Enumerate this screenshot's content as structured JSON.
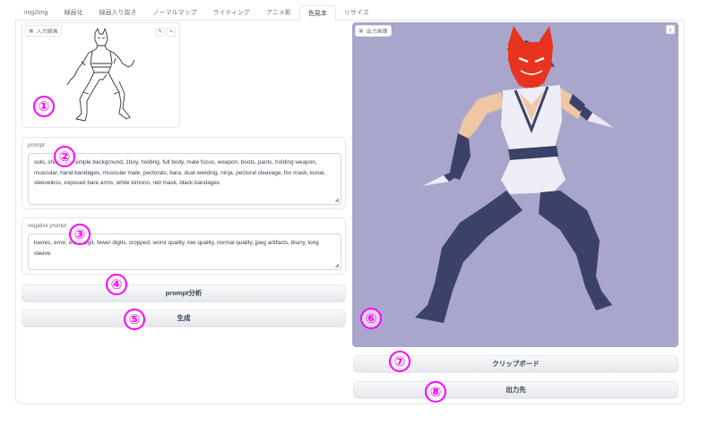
{
  "tabs": [
    "img2img",
    "線画化",
    "線画入り抜き",
    "ノーマルマップ",
    "ライティング",
    "アニメ影",
    "色見本",
    "リサイズ"
  ],
  "input_image": {
    "label": "入力線画",
    "edit_icon": "✎",
    "close_icon": "×"
  },
  "prompt": {
    "label": "prompt",
    "value": "solo, short hair, simple background, 1boy, holding, full body, male focus, weapon, boots, pants, holding weapon, muscular, hand bandages, muscular male, pectorals, bara, dual wielding, ninja, pectoral cleavage, fox mask, kunai, sleeveless, exposed bare arms,  white kimono, red mask, black bandages"
  },
  "negative_prompt": {
    "label": "negative prompt",
    "value": "lowres, error, extra digit, fewer digits, cropped, worst quality, low quality, normal quality, jpeg artifacts, blurry, long sleeve"
  },
  "buttons": {
    "analyze": "prompt分析",
    "generate": "生成",
    "clipboard": "クリップボード",
    "output_dest": "出力先"
  },
  "output_image": {
    "label": "出力画像",
    "download_icon": "⤓"
  },
  "badges": [
    "①",
    "②",
    "③",
    "④",
    "⑤",
    "⑥",
    "⑦",
    "⑧"
  ],
  "colors": {
    "badge": "#ff00ff",
    "output_bg": "#a9a6cc",
    "mask_red": "#e8331f",
    "clothes_navy": "#3b4168",
    "skin": "#efc7a4"
  }
}
